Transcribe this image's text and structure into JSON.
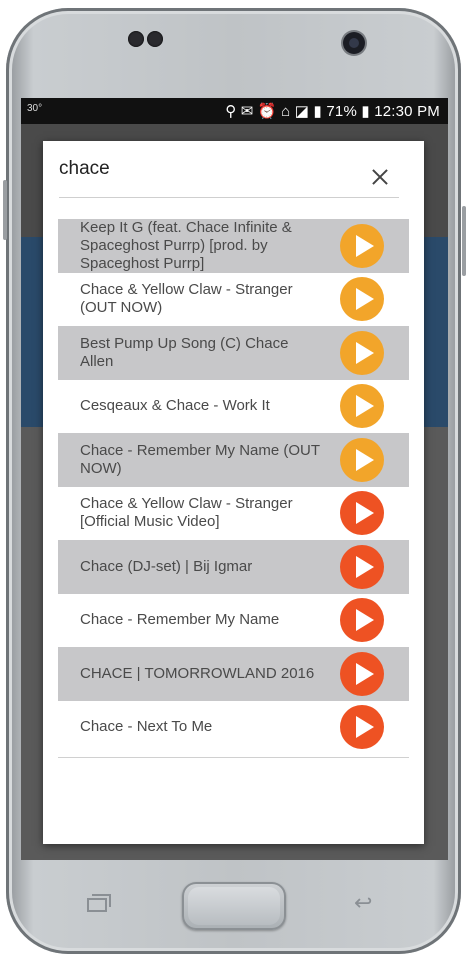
{
  "status_bar": {
    "left_text": "30°",
    "battery": "71%",
    "time": "12:30 PM"
  },
  "search": {
    "value": "chace",
    "placeholder": ""
  },
  "colors": {
    "play_yellow": "#f2a52a",
    "play_orange": "#ee5223"
  },
  "results": [
    {
      "title": "Keep It G (feat. Chace Infinite & Spaceghost Purrp) [prod. by Spaceghost Purrp]",
      "shaded": true,
      "color": "#f2a52a"
    },
    {
      "title": "Chace & Yellow Claw - Stranger (OUT NOW)",
      "shaded": false,
      "color": "#f2a52a"
    },
    {
      "title": "Best Pump Up Song (C) Chace Allen",
      "shaded": true,
      "color": "#f2a52a"
    },
    {
      "title": "Cesqeaux & Chace - Work It",
      "shaded": false,
      "color": "#f2a52a"
    },
    {
      "title": "Chace - Remember My Name (OUT NOW)",
      "shaded": true,
      "color": "#f2a52a"
    },
    {
      "title": "Chace & Yellow Claw - Stranger [Official Music Video]",
      "shaded": false,
      "color": "#ee5223"
    },
    {
      "title": "Chace (DJ-set) | Bij Igmar",
      "shaded": true,
      "color": "#ee5223"
    },
    {
      "title": "Chace - Remember My Name",
      "shaded": false,
      "color": "#ee5223"
    },
    {
      "title": "CHACE | TOMORROWLAND 2016",
      "shaded": true,
      "color": "#ee5223"
    },
    {
      "title": "Chace - Next To Me",
      "shaded": false,
      "color": "#ee5223"
    }
  ]
}
